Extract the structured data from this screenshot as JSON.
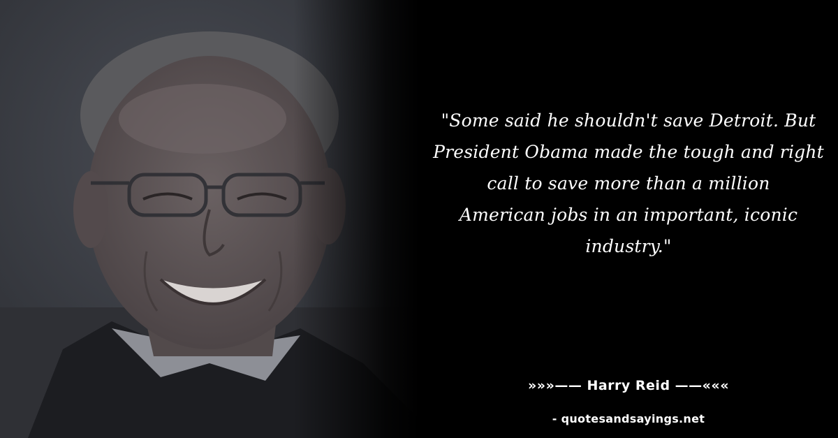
{
  "quote": {
    "lines": [
      "\"Some said he shouldn't save Detroit. But",
      "President Obama made the tough and right",
      "call to save more than a million",
      "American jobs in an important, iconic",
      "industry.\""
    ]
  },
  "attribution": {
    "author_line": "»»»—— Harry Reid ——«««"
  },
  "footer": {
    "site": "- quotesandsayings.net"
  },
  "colors": {
    "background": "#000000",
    "text": "#ffffff"
  },
  "photo": {
    "subject": "portrait-photo",
    "icon": "person-photo"
  }
}
